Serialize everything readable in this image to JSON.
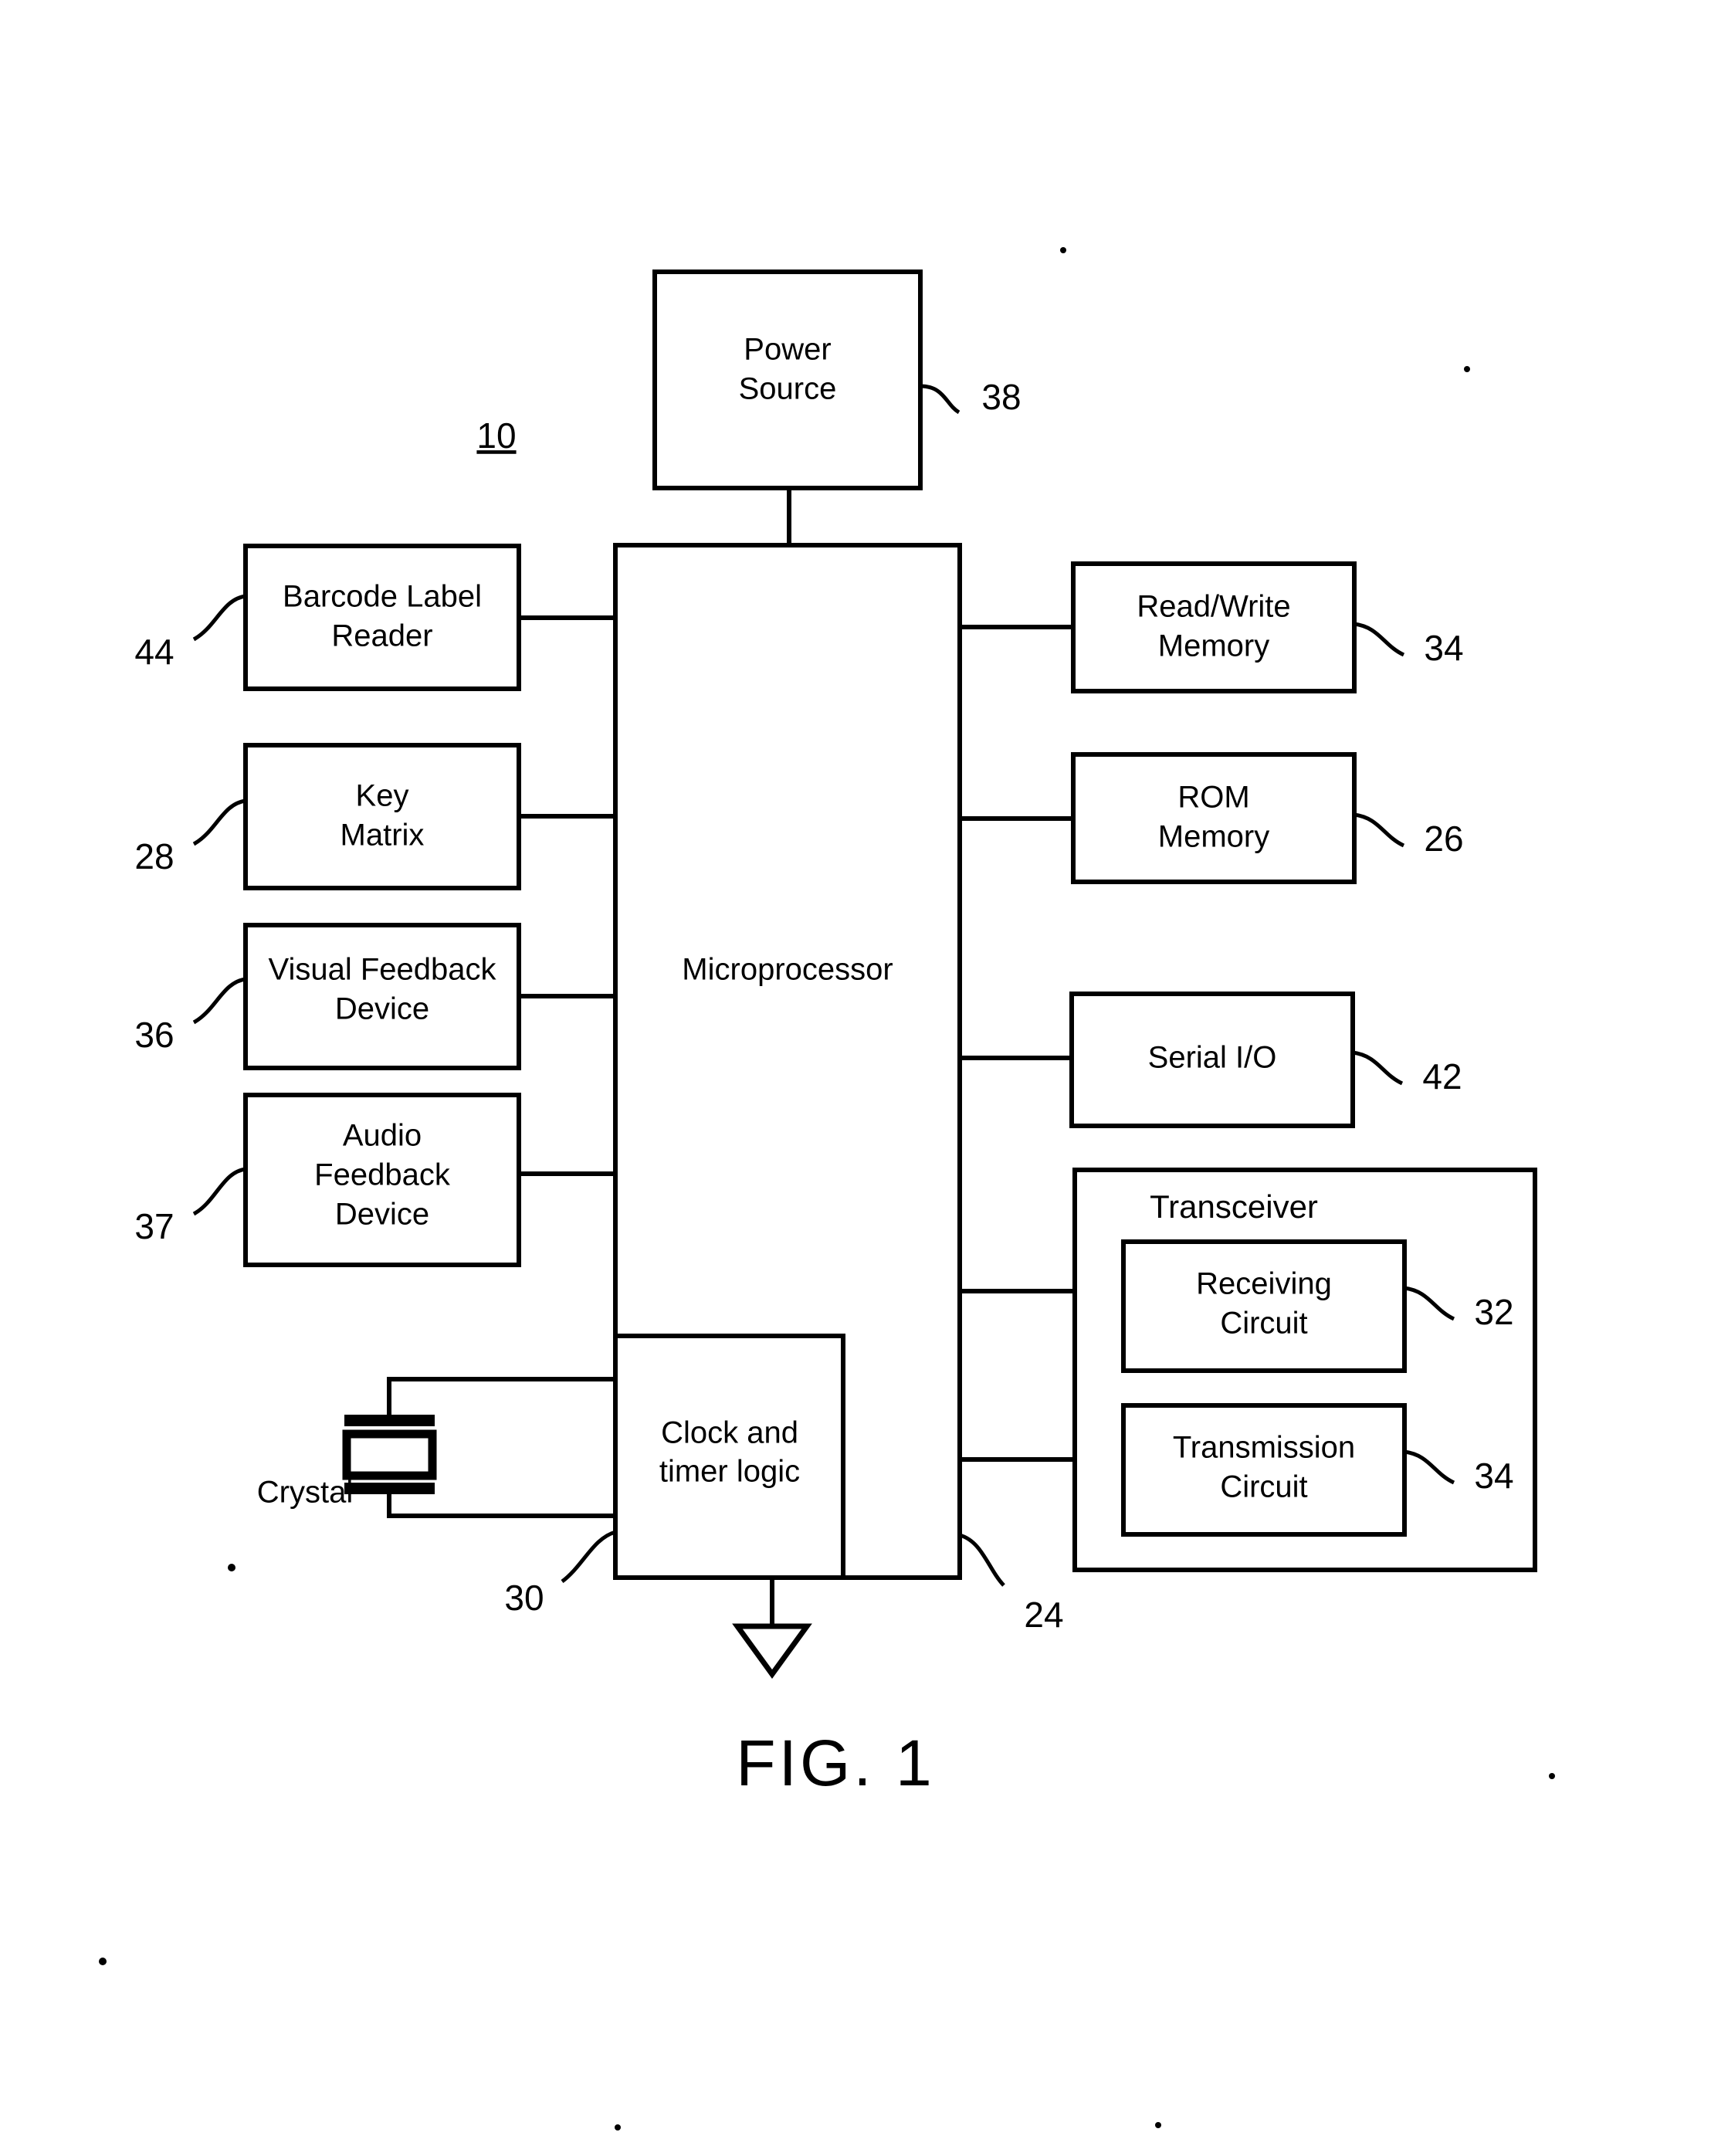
{
  "figure": {
    "caption": "FIG. 1",
    "assembly_ref": "10"
  },
  "blocks": {
    "power_source": {
      "label_line1": "Power",
      "label_line2": "Source",
      "ref": "38"
    },
    "barcode_reader": {
      "label_line1": "Barcode  Label",
      "label_line2": "Reader",
      "ref": "44"
    },
    "key_matrix": {
      "label_line1": "Key",
      "label_line2": "Matrix",
      "ref": "28"
    },
    "visual_feedback": {
      "label_line1": "Visual  Feedback",
      "label_line2": "Device",
      "ref": "36"
    },
    "audio_feedback": {
      "label_line1": "Audio",
      "label_line2": "Feedback",
      "label_line3": "Device",
      "ref": "37"
    },
    "microprocessor": {
      "label": "Microprocessor",
      "ref": "24"
    },
    "clock_timer": {
      "label_line1": "Clock  and",
      "label_line2": "timer  logic",
      "ref": "30"
    },
    "crystal": {
      "label": "Crystal"
    },
    "read_write_memory": {
      "label_line1": "Read/Write",
      "label_line2": "Memory",
      "ref": "34"
    },
    "rom_memory": {
      "label_line1": "ROM",
      "label_line2": "Memory",
      "ref": "26"
    },
    "serial_io": {
      "label": "Serial  I/O",
      "ref": "42"
    },
    "transceiver": {
      "label": "Transceiver"
    },
    "receiving_circuit": {
      "label_line1": "Receiving",
      "label_line2": "Circuit",
      "ref": "32"
    },
    "transmission_circuit": {
      "label_line1": "Transmission",
      "label_line2": "Circuit",
      "ref": "34"
    }
  },
  "colors": {
    "ink": "#000000",
    "paper": "#ffffff"
  }
}
